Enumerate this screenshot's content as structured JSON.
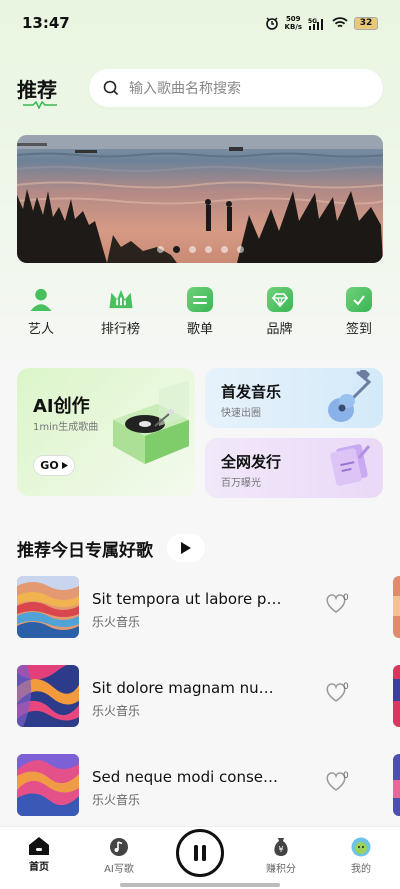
{
  "status": {
    "time": "13:47",
    "net_speed": "509",
    "net_unit": "KB/s",
    "signal": "5G",
    "battery": "32"
  },
  "header": {
    "title": "推荐",
    "search_placeholder": "输入歌曲名称搜索"
  },
  "banner": {
    "page_count": 6,
    "active_index": 1
  },
  "quick_nav": [
    {
      "label": "艺人",
      "icon": "person-icon"
    },
    {
      "label": "排行榜",
      "icon": "crown-icon"
    },
    {
      "label": "歌单",
      "icon": "list-icon"
    },
    {
      "label": "品牌",
      "icon": "diamond-icon"
    },
    {
      "label": "签到",
      "icon": "check-icon"
    }
  ],
  "cards": {
    "ai": {
      "title": "AI创作",
      "subtitle": "1min生成歌曲",
      "button": "GO"
    },
    "music": {
      "title": "首发音乐",
      "subtitle": "快速出圈"
    },
    "release": {
      "title": "全网发行",
      "subtitle": "百万曝光"
    }
  },
  "section": {
    "title": "推荐今日专属好歌"
  },
  "songs": [
    {
      "title": "Sit tempora ut labore po…",
      "artist": "乐火音乐",
      "likes": "0"
    },
    {
      "title": "Sit dolore magnam num…",
      "artist": "乐火音乐",
      "likes": "0"
    },
    {
      "title": "Sed neque modi consect…",
      "artist": "乐火音乐",
      "likes": "0"
    }
  ],
  "bottom_nav": [
    {
      "label": "首页",
      "icon": "home-icon",
      "active": true
    },
    {
      "label": "AI写歌",
      "icon": "music-note-icon",
      "active": false
    },
    {
      "label": "赚积分",
      "icon": "money-bag-icon",
      "active": false
    },
    {
      "label": "我的",
      "icon": "avatar-icon",
      "active": false
    }
  ],
  "colors": {
    "accent_green": "#39b654",
    "background": "#f6f7f6"
  }
}
